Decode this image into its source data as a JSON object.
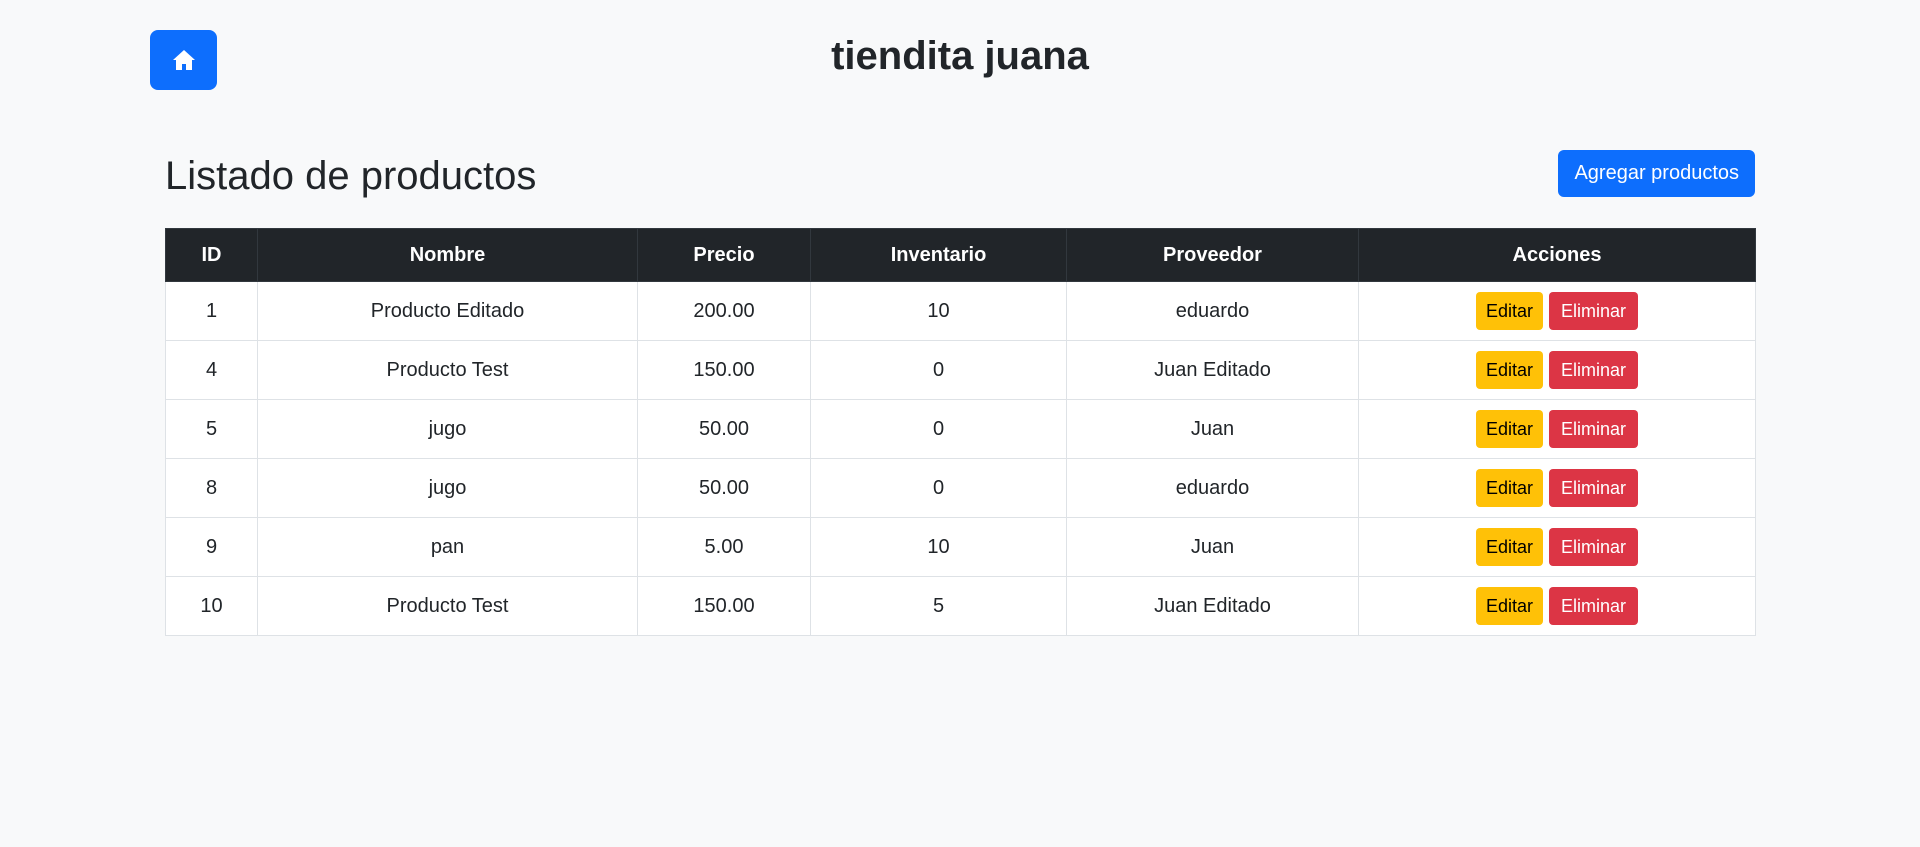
{
  "header": {
    "home_icon": "home-icon",
    "title": "tiendita juana"
  },
  "page": {
    "title": "Listado de productos",
    "add_button": "Agregar productos"
  },
  "table": {
    "columns": [
      "ID",
      "Nombre",
      "Precio",
      "Inventario",
      "Proveedor",
      "Acciones"
    ],
    "rows": [
      {
        "id": "1",
        "nombre": "Producto Editado",
        "precio": "200.00",
        "inventario": "10",
        "proveedor": "eduardo"
      },
      {
        "id": "4",
        "nombre": "Producto Test",
        "precio": "150.00",
        "inventario": "0",
        "proveedor": "Juan Editado"
      },
      {
        "id": "5",
        "nombre": "jugo",
        "precio": "50.00",
        "inventario": "0",
        "proveedor": "Juan"
      },
      {
        "id": "8",
        "nombre": "jugo",
        "precio": "50.00",
        "inventario": "0",
        "proveedor": "eduardo"
      },
      {
        "id": "9",
        "nombre": "pan",
        "precio": "5.00",
        "inventario": "10",
        "proveedor": "Juan"
      },
      {
        "id": "10",
        "nombre": "Producto Test",
        "precio": "150.00",
        "inventario": "5",
        "proveedor": "Juan Editado"
      }
    ],
    "edit_label": "Editar",
    "delete_label": "Eliminar"
  },
  "colors": {
    "primary": "#0d6efd",
    "warning": "#ffc107",
    "danger": "#dc3545",
    "table_header": "#212529",
    "background": "#f8f9fa"
  }
}
